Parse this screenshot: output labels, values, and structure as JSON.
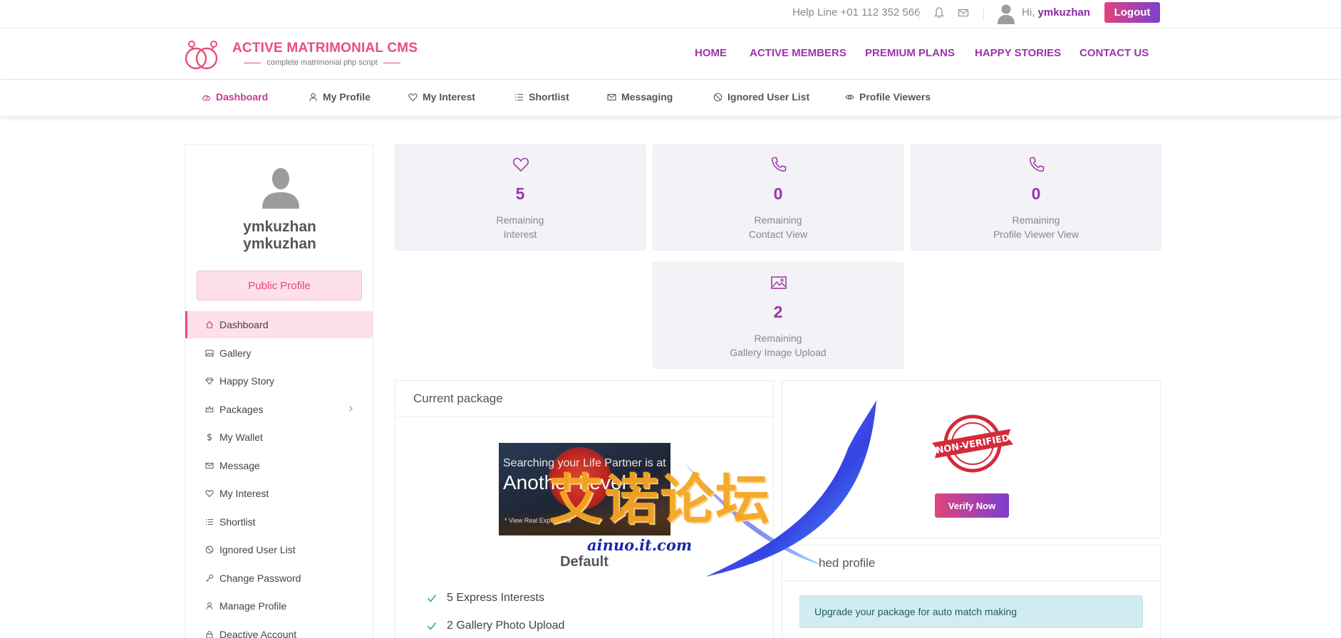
{
  "topbar": {
    "helpline": "Help Line +01 112 352 566",
    "greeting": "Hi,",
    "username": "ymkuzhan",
    "logout_label": "Logout"
  },
  "brand": {
    "title": "ACTIVE MATRIMONIAL CMS",
    "subtitle": "complete matrimonial php script"
  },
  "main_nav": [
    {
      "label": "HOME"
    },
    {
      "label": "ACTIVE MEMBERS"
    },
    {
      "label": "PREMIUM PLANS"
    },
    {
      "label": "HAPPY STORIES"
    },
    {
      "label": "CONTACT US"
    }
  ],
  "sub_nav": [
    {
      "label": "Dashboard",
      "icon": "dashboard-icon",
      "active": true
    },
    {
      "label": "My Profile",
      "icon": "user-icon"
    },
    {
      "label": "My Interest",
      "icon": "heart-icon"
    },
    {
      "label": "Shortlist",
      "icon": "list-icon"
    },
    {
      "label": "Messaging",
      "icon": "mail-icon"
    },
    {
      "label": "Ignored User List",
      "icon": "ban-icon"
    },
    {
      "label": "Profile Viewers",
      "icon": "eye-icon"
    }
  ],
  "sidebar": {
    "name_line1": "ymkuzhan",
    "name_line2": "ymkuzhan",
    "public_profile_label": "Public Profile",
    "items": [
      {
        "label": "Dashboard",
        "icon": "home-icon",
        "active": true
      },
      {
        "label": "Gallery",
        "icon": "image-icon"
      },
      {
        "label": "Happy Story",
        "icon": "diamond-icon"
      },
      {
        "label": "Packages",
        "icon": "crown-icon",
        "has_submenu": true
      },
      {
        "label": "My Wallet",
        "icon": "dollar-icon"
      },
      {
        "label": "Message",
        "icon": "mail-icon"
      },
      {
        "label": "My Interest",
        "icon": "heart-icon"
      },
      {
        "label": "Shortlist",
        "icon": "list-icon"
      },
      {
        "label": "Ignored User List",
        "icon": "ban-icon"
      },
      {
        "label": "Change Password",
        "icon": "key-icon"
      },
      {
        "label": "Manage Profile",
        "icon": "user-icon"
      },
      {
        "label": "Deactive Account",
        "icon": "lock-icon"
      }
    ]
  },
  "stats": [
    {
      "value": "5",
      "line1": "Remaining",
      "line2": "Interest",
      "icon": "heart-icon"
    },
    {
      "value": "0",
      "line1": "Remaining",
      "line2": "Contact View",
      "icon": "phone-icon"
    },
    {
      "value": "0",
      "line1": "Remaining",
      "line2": "Profile Viewer View",
      "icon": "phone-icon"
    },
    {
      "value": "2",
      "line1": "Remaining",
      "line2": "Gallery Image Upload",
      "icon": "image-icon"
    }
  ],
  "current_package": {
    "title": "Current package",
    "banner_line1": "Searching your Life Partner is at",
    "banner_line2": "Another Level",
    "banner_line3": "* View Real Experience",
    "name": "Default",
    "features": [
      "5 Express Interests",
      "2 Gallery Photo Upload"
    ]
  },
  "verification": {
    "stamp_text": "NON-VERIFIED",
    "verify_label": "Verify Now"
  },
  "matched_profile": {
    "title_visible": "hed profile",
    "alert": "Upgrade your package for auto match making"
  },
  "watermark": {
    "text": "艾诺论坛",
    "url": "ainuo.it.com"
  },
  "colors": {
    "accent_purple": "#9b35a8",
    "accent_pink": "#ec4d7a",
    "stat_bg": "#f2f2f7"
  }
}
